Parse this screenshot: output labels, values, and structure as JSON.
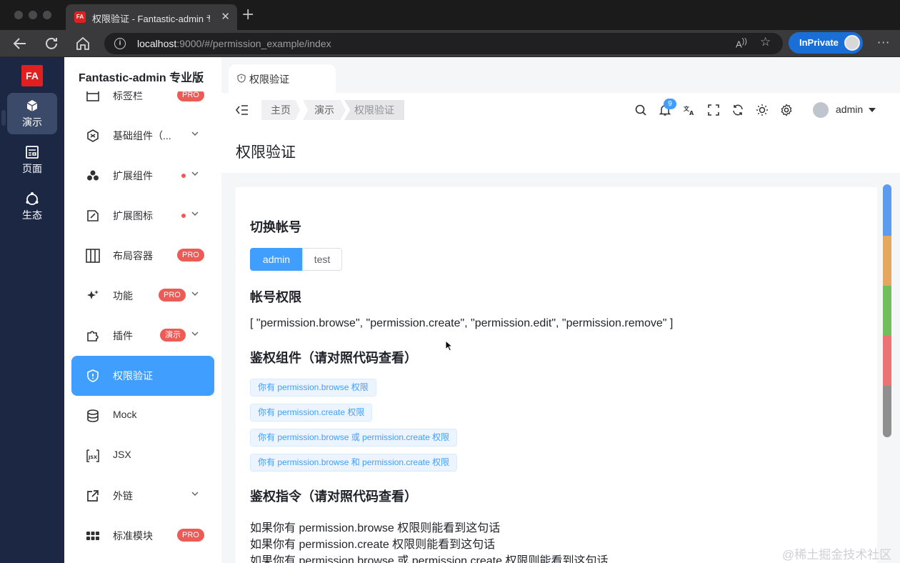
{
  "browser": {
    "tab_title": "权限验证 - Fantastic-admin 专业版",
    "favicon_text": "FA",
    "url_host": "localhost",
    "url_rest": ":9000/#/permission_example/index",
    "inprivate_label": "InPrivate"
  },
  "app": {
    "logo_text": "FA",
    "main_nav": [
      {
        "label": "演示",
        "icon": "cube-icon",
        "active": true
      },
      {
        "label": "页面",
        "icon": "page-icon",
        "active": false
      },
      {
        "label": "生态",
        "icon": "ecosystem-icon",
        "active": false
      }
    ],
    "sub_title": "Fantastic-admin 专业版",
    "menu": [
      {
        "label": "标签栏",
        "icon": "tabbar-icon",
        "badge": "PRO"
      },
      {
        "label": "基础组件（...",
        "icon": "component-icon",
        "chevron": true
      },
      {
        "label": "扩展组件",
        "icon": "extend-component-icon",
        "dot": true,
        "chevron": true
      },
      {
        "label": "扩展图标",
        "icon": "extend-icon-icon",
        "dot": true,
        "chevron": true
      },
      {
        "label": "布局容器",
        "icon": "layout-icon",
        "badge": "PRO"
      },
      {
        "label": "功能",
        "icon": "sparkle-icon",
        "badge": "PRO",
        "chevron": true
      },
      {
        "label": "插件",
        "icon": "plugin-icon",
        "badge": "演示",
        "chevron": true
      },
      {
        "label": "权限验证",
        "icon": "shield-icon",
        "active": true
      },
      {
        "label": "Mock",
        "icon": "database-icon"
      },
      {
        "label": "JSX",
        "icon": "jsx-icon"
      },
      {
        "label": "外链",
        "icon": "external-link-icon",
        "chevron": true
      },
      {
        "label": "标准模块",
        "icon": "grid-icon",
        "badge": "PRO"
      }
    ],
    "page_tab": "权限验证",
    "breadcrumb": [
      "主页",
      "演示",
      "权限验证"
    ],
    "notice_count": "9",
    "user": "admin",
    "page_title": "权限验证",
    "sections": {
      "switch_title": "切换帐号",
      "accounts": [
        "admin",
        "test"
      ],
      "perm_title": "帐号权限",
      "perm_list": "[ \"permission.browse\", \"permission.create\", \"permission.edit\", \"permission.remove\" ]",
      "component_title": "鉴权组件（请对照代码查看）",
      "component_tags": [
        "你有 permission.browse 权限",
        "你有 permission.create 权限",
        "你有 permission.browse 或 permission.create 权限",
        "你有 permission.browse 和 permission.create 权限"
      ],
      "directive_title": "鉴权指令（请对照代码查看）",
      "directive_lines": [
        "如果你有 permission.browse 权限则能看到这句话",
        "如果你有 permission.create 权限则能看到这句话",
        "如果你有 permission.browse 或 permission.create 权限则能看到这句话"
      ]
    },
    "watermark": "@稀土掘金技术社区",
    "colors": {
      "primary": "#409eff",
      "sidebar": "#1c2743",
      "logo": "#e02020",
      "badge": "#ec5b56"
    }
  }
}
